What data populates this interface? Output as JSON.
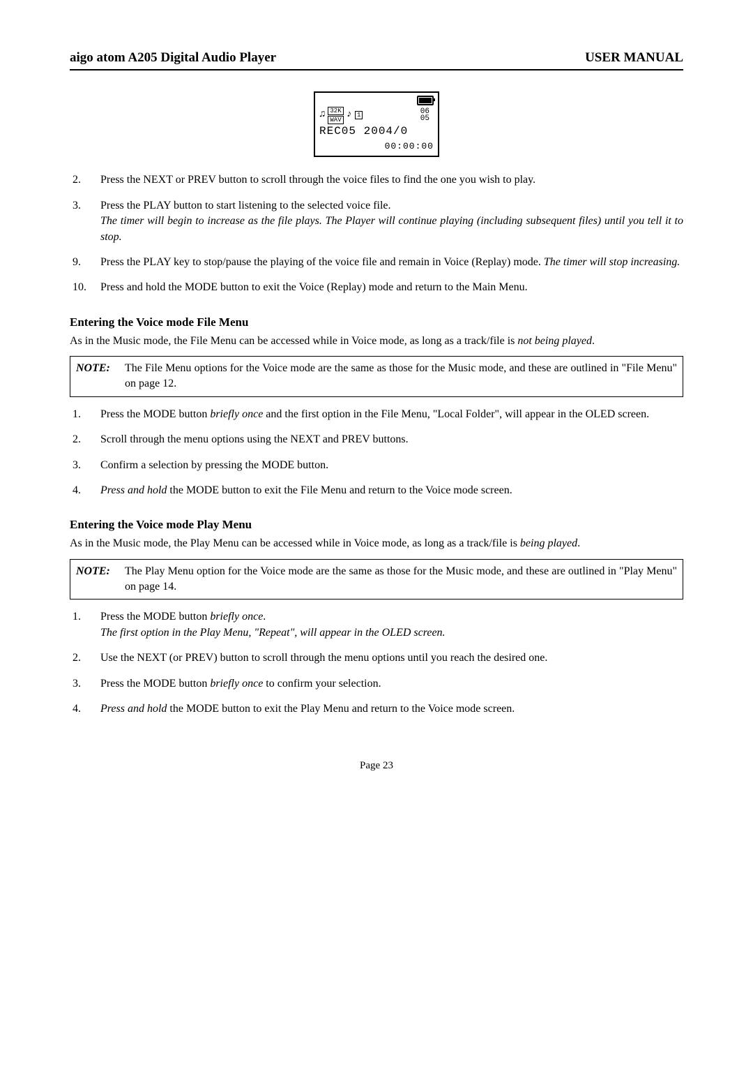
{
  "header": {
    "left": "aigo atom A205 Digital Audio Player",
    "right": "USER MANUAL"
  },
  "oled": {
    "num_top": "06",
    "num_bottom": "05",
    "line": "REC05 2004/0",
    "timer": "00:00:00",
    "box1": "32K",
    "box2": "WAV",
    "box3": "1"
  },
  "list1": {
    "i2": {
      "n": "2.",
      "t": "Press the NEXT or PREV button to scroll through the voice files to find the one you wish to play."
    },
    "i3": {
      "n": "3.",
      "t": "Press the PLAY button to start listening to the selected voice file.",
      "t2a": "The timer will begin to increase as the file plays.",
      "t2b": "  The Player will continue playing (including subsequent files) until you tell it to stop."
    },
    "i9": {
      "n": "9.",
      "t": "Press the PLAY key to stop/pause the playing of the voice file and remain in Voice (Replay) mode.   ",
      "t2": "The timer will stop increasing."
    },
    "i10": {
      "n": "10.",
      "t": "Press and hold the MODE button to exit the Voice (Replay) mode and return to the Main Menu."
    }
  },
  "sectionA": {
    "title": "Entering the Voice mode File Menu",
    "para_a": "As in the Music mode, the File Menu can be accessed while in Voice mode, as long as a track/file is ",
    "para_b": "not being played",
    "para_c": "."
  },
  "noteA": {
    "label": "NOTE:",
    "body": "The File Menu options for the Voice mode are the same as those for the Music mode, and these are outlined in \"File Menu\" on page 12."
  },
  "list2": {
    "i1": {
      "n": "1.",
      "a": "Press the MODE button ",
      "b": "briefly once",
      "c": " and the first option in the File Menu, \"Local Folder\", will appear in the OLED screen."
    },
    "i2": {
      "n": "2.",
      "t": "Scroll through the menu options using the NEXT and PREV buttons."
    },
    "i3": {
      "n": "3.",
      "t": "Confirm a selection by pressing the MODE button."
    },
    "i4": {
      "n": "4.",
      "a": "Press and hold",
      "b": " the MODE button to exit the File Menu and return to the Voice mode screen."
    }
  },
  "sectionB": {
    "title": "Entering the Voice mode Play Menu",
    "para_a": "As in the Music mode, the Play Menu can be accessed while in Voice mode, as long as a track/file is ",
    "para_b": "being played",
    "para_c": "."
  },
  "noteB": {
    "label": "NOTE:",
    "body": "The Play Menu option for the Voice mode are the same as those for the Music mode, and these are outlined in \"Play Menu\" on page 14."
  },
  "list3": {
    "i1": {
      "n": "1.",
      "a": "Press the MODE button ",
      "b": "briefly once",
      "c": ".",
      "d": "The first option in the Play Menu, \"Repeat\", will appear in the OLED screen."
    },
    "i2": {
      "n": "2.",
      "t": "Use the NEXT (or PREV) button to scroll through the menu options until you reach the desired one."
    },
    "i3": {
      "n": "3.",
      "a": "Press the MODE button ",
      "b": "briefly once",
      "c": " to confirm your selection."
    },
    "i4": {
      "n": "4.",
      "a": "Press and hold",
      "b": " the MODE button to exit the Play Menu and return to the Voice mode screen."
    }
  },
  "footer": {
    "page": "Page 23"
  }
}
